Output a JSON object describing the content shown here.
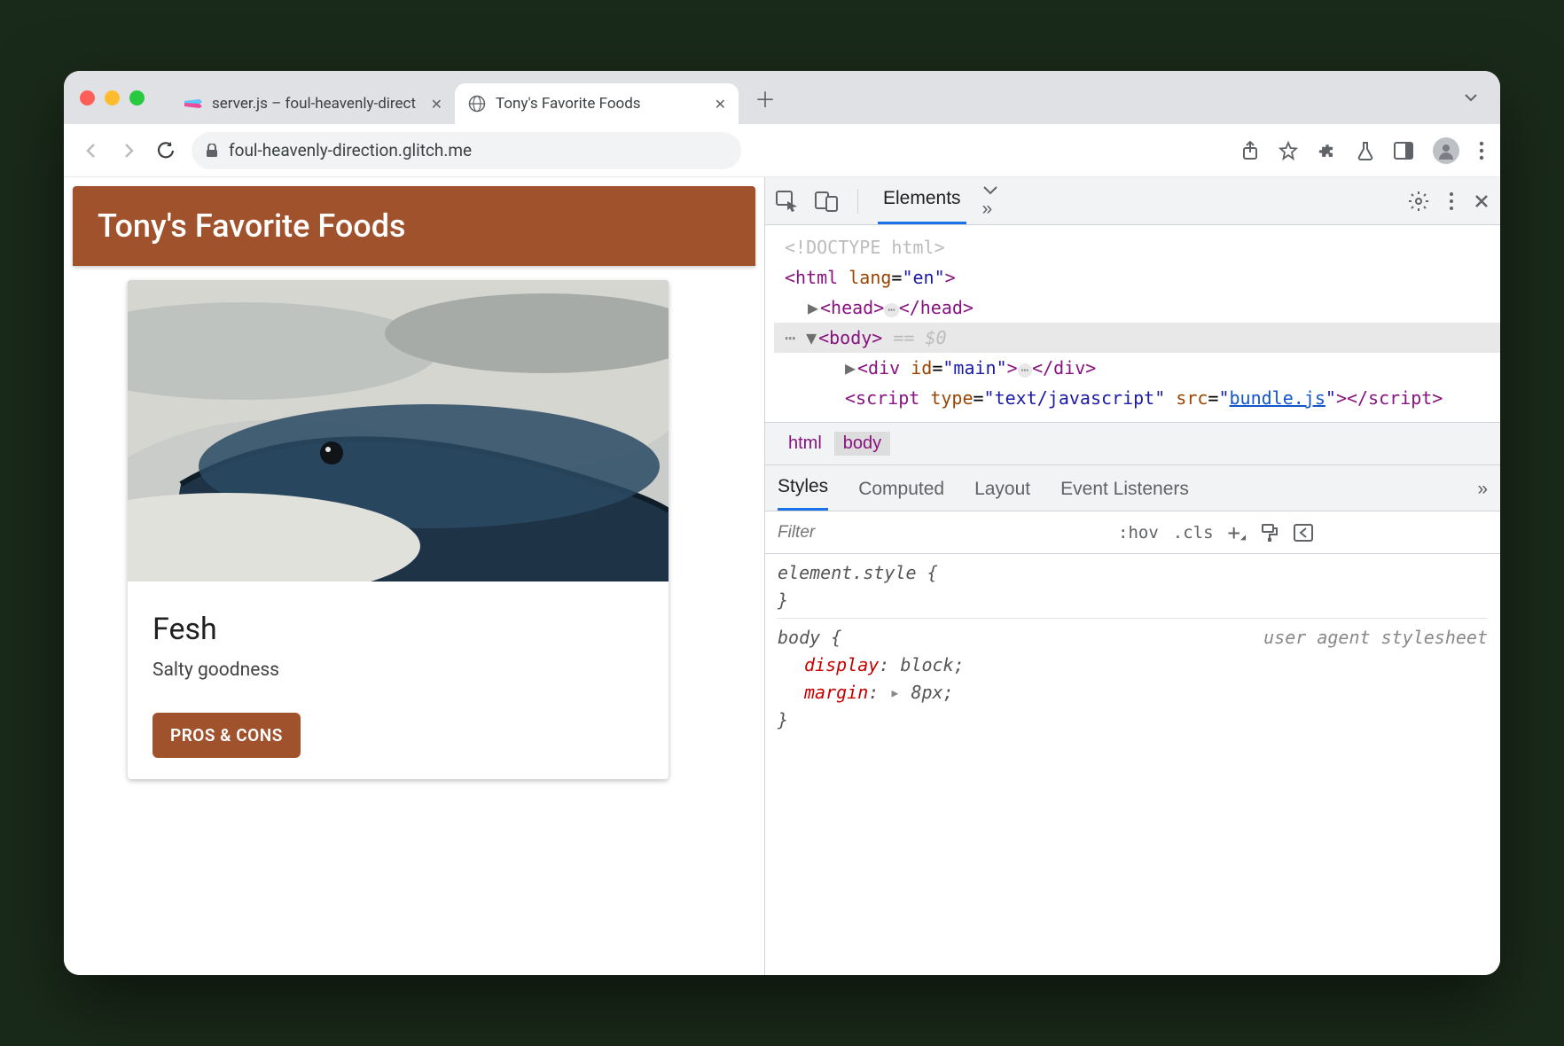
{
  "tabs": [
    {
      "title": "server.js – foul-heavenly-direct",
      "favicon": "glitch-icon",
      "active": false
    },
    {
      "title": "Tony's Favorite Foods",
      "favicon": "globe-icon",
      "active": true
    }
  ],
  "toolbar": {
    "url": "foul-heavenly-direction.glitch.me"
  },
  "page": {
    "header_title": "Tony's Favorite Foods",
    "card": {
      "title": "Fesh",
      "subtitle": "Salty goodness",
      "button_label": "PROS & CONS"
    }
  },
  "devtools": {
    "main_tabs": {
      "active": "Elements"
    },
    "dom": {
      "line_doctype": "<!DOCTYPE html>",
      "html_open": {
        "tag": "html",
        "attr": "lang",
        "val": "en"
      },
      "head": {
        "tag": "head"
      },
      "body": {
        "tag": "body",
        "sel_note": "== $0"
      },
      "div": {
        "tag": "div",
        "attr": "id",
        "val": "main"
      },
      "script": {
        "tag": "script",
        "attr1": "type",
        "val1": "text/javascript",
        "attr2": "src",
        "link": "bundle.js"
      }
    },
    "breadcrumb": [
      "html",
      "body"
    ],
    "styles_tabs": [
      "Styles",
      "Computed",
      "Layout",
      "Event Listeners"
    ],
    "styles_toolbar": {
      "filter_placeholder": "Filter",
      "hov": ":hov",
      "cls": ".cls"
    },
    "styles": {
      "element_style": "element.style {",
      "body_rule": {
        "selector": "body {",
        "src": "user agent stylesheet",
        "props": [
          {
            "name": "display",
            "value": "block;"
          },
          {
            "name": "margin",
            "value": "8px;",
            "expandable": true
          }
        ],
        "close": "}"
      }
    }
  }
}
